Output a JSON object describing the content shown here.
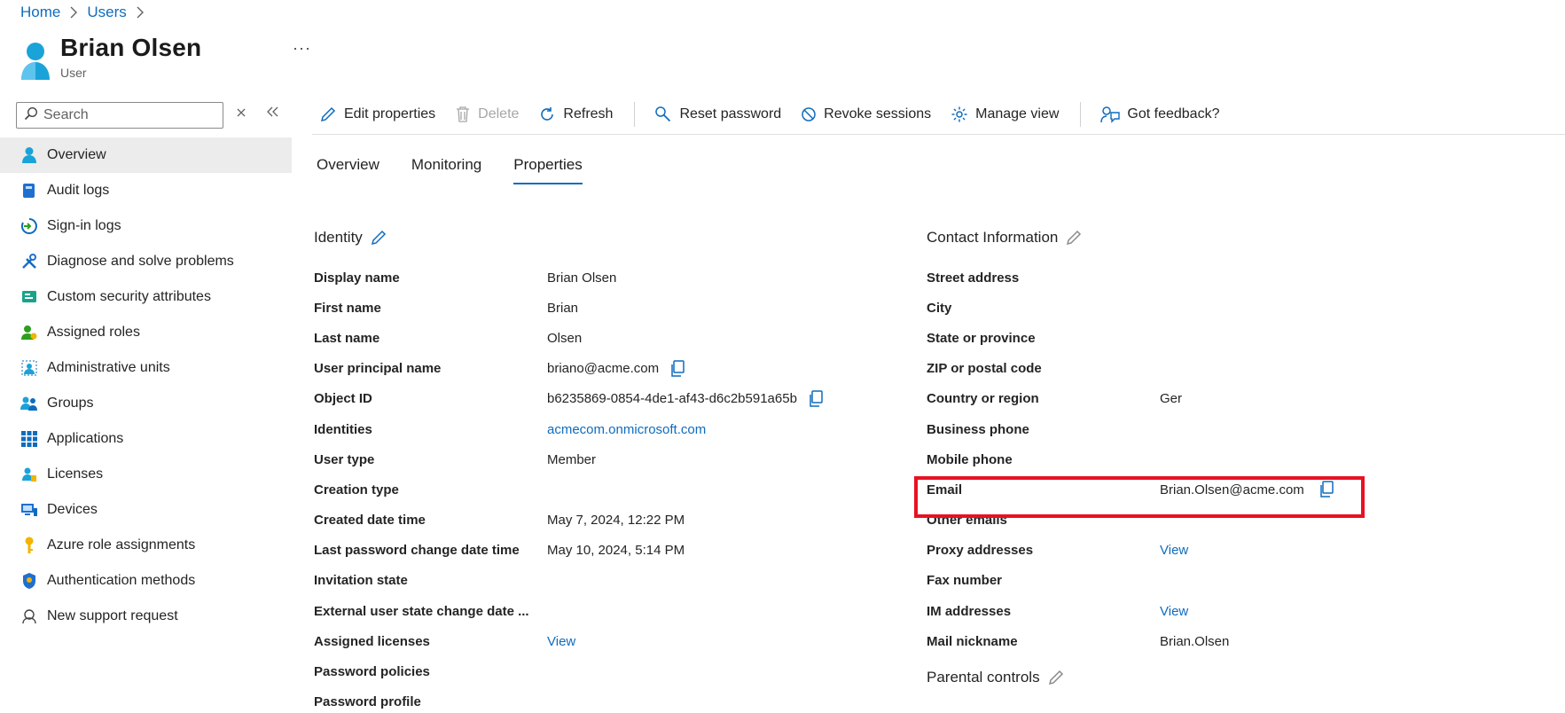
{
  "breadcrumb": {
    "home": "Home",
    "users": "Users"
  },
  "header": {
    "title": "Brian Olsen",
    "subtitle": "User",
    "more": "···"
  },
  "search": {
    "placeholder": "Search"
  },
  "sidebar": {
    "items": [
      {
        "label": "Overview",
        "icon": "user-icon"
      },
      {
        "label": "Audit logs",
        "icon": "audit-log-icon"
      },
      {
        "label": "Sign-in logs",
        "icon": "sign-in-icon"
      },
      {
        "label": "Diagnose and solve problems",
        "icon": "wrench-icon"
      },
      {
        "label": "Custom security attributes",
        "icon": "security-attributes-icon"
      },
      {
        "label": "Assigned roles",
        "icon": "role-icon"
      },
      {
        "label": "Administrative units",
        "icon": "admin-units-icon"
      },
      {
        "label": "Groups",
        "icon": "groups-icon"
      },
      {
        "label": "Applications",
        "icon": "apps-grid-icon"
      },
      {
        "label": "Licenses",
        "icon": "license-icon"
      },
      {
        "label": "Devices",
        "icon": "devices-icon"
      },
      {
        "label": "Azure role assignments",
        "icon": "key-icon"
      },
      {
        "label": "Authentication methods",
        "icon": "shield-icon"
      },
      {
        "label": "New support request",
        "icon": "support-icon"
      }
    ]
  },
  "toolbar": {
    "edit": "Edit properties",
    "delete": "Delete",
    "refresh": "Refresh",
    "reset": "Reset password",
    "revoke": "Revoke sessions",
    "manage": "Manage view",
    "feedback": "Got feedback?"
  },
  "tabs": [
    "Overview",
    "Monitoring",
    "Properties"
  ],
  "identity": {
    "title": "Identity",
    "rows": [
      {
        "label": "Display name",
        "value": "Brian Olsen"
      },
      {
        "label": "First name",
        "value": "Brian"
      },
      {
        "label": "Last name",
        "value": "Olsen"
      },
      {
        "label": "User principal name",
        "value": "briano@acme.com"
      },
      {
        "label": "Object ID",
        "value": "b6235869-0854-4de1-af43-d6c2b591a65b"
      },
      {
        "label": "Identities",
        "value": "acmecom.onmicrosoft.com"
      },
      {
        "label": "User type",
        "value": "Member"
      },
      {
        "label": "Creation type",
        "value": ""
      },
      {
        "label": "Created date time",
        "value": "May 7, 2024, 12:22 PM"
      },
      {
        "label": "Last password change date time",
        "value": "May 10, 2024, 5:14 PM"
      },
      {
        "label": "Invitation state",
        "value": ""
      },
      {
        "label": "External user state change date ...",
        "value": ""
      },
      {
        "label": "Assigned licenses",
        "value": "View"
      },
      {
        "label": "Password policies",
        "value": ""
      },
      {
        "label": "Password profile",
        "value": ""
      }
    ]
  },
  "contact": {
    "title": "Contact Information",
    "rows": [
      {
        "label": "Street address",
        "value": ""
      },
      {
        "label": "City",
        "value": ""
      },
      {
        "label": "State or province",
        "value": ""
      },
      {
        "label": "ZIP or postal code",
        "value": ""
      },
      {
        "label": "Country or region",
        "value": "Ger"
      },
      {
        "label": "Business phone",
        "value": ""
      },
      {
        "label": "Mobile phone",
        "value": ""
      },
      {
        "label": "Email",
        "value": "Brian.Olsen@acme.com"
      },
      {
        "label": "Other emails",
        "value": ""
      },
      {
        "label": "Proxy addresses",
        "value": "View"
      },
      {
        "label": "Fax number",
        "value": ""
      },
      {
        "label": "IM addresses",
        "value": "View"
      },
      {
        "label": "Mail nickname",
        "value": "Brian.Olsen"
      }
    ]
  },
  "parental": {
    "title": "Parental controls"
  },
  "colors": {
    "accent": "#0f6cbd",
    "highlight": "#e81123",
    "activeNav": "#ececec"
  }
}
